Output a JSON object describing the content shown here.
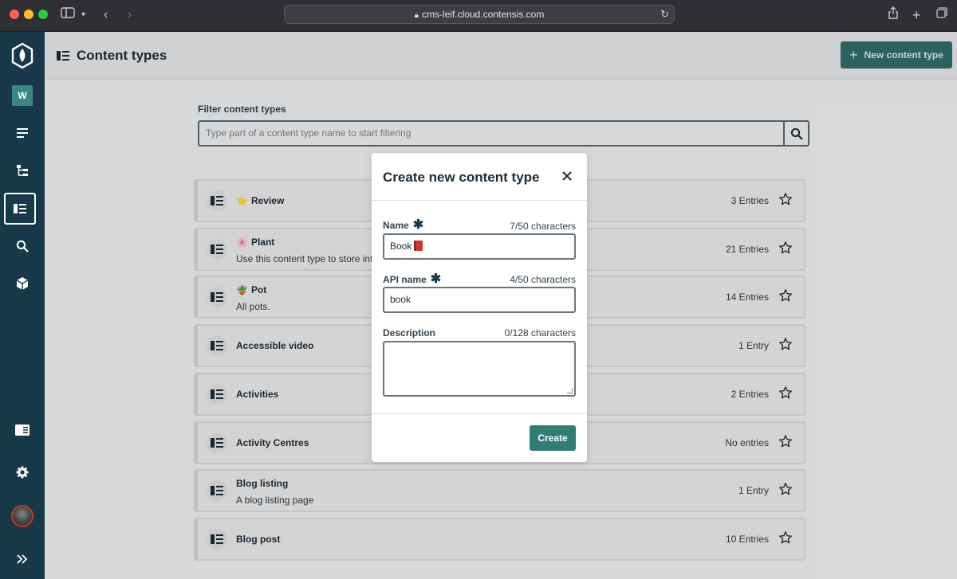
{
  "browser": {
    "url": "cms-leif.cloud.contensis.com"
  },
  "sidebar": {
    "workspace_initial": "W"
  },
  "header": {
    "title": "Content types",
    "new_button_label": "New content type"
  },
  "filter": {
    "label": "Filter content types",
    "placeholder": "Type part of a content type name to start filtering"
  },
  "content_types": [
    {
      "emoji": "⭐",
      "name": "Review",
      "description": "",
      "count": "3 Entries"
    },
    {
      "emoji": "🌸",
      "name": "Plant",
      "description": "Use this content type to store inf",
      "count": "21 Entries"
    },
    {
      "emoji": "🪴",
      "name": "Pot",
      "description": "All pots.",
      "count": "14 Entries"
    },
    {
      "emoji": "",
      "name": "Accessible video",
      "description": "",
      "count": "1 Entry"
    },
    {
      "emoji": "",
      "name": "Activities",
      "description": "",
      "count": "2 Entries"
    },
    {
      "emoji": "",
      "name": "Activity Centres",
      "description": "",
      "count": "No entries"
    },
    {
      "emoji": "",
      "name": "Blog listing",
      "description": "A blog listing page",
      "count": "1 Entry"
    },
    {
      "emoji": "",
      "name": "Blog post",
      "description": "",
      "count": "10 Entries"
    }
  ],
  "modal": {
    "title": "Create new content type",
    "name_label": "Name",
    "name_count": "7/50 characters",
    "name_value": "Book",
    "api_label": "API name",
    "api_count": "4/50 characters",
    "api_value": "book",
    "description_label": "Description",
    "description_count": "0/128 characters",
    "description_value": "",
    "create_label": "Create"
  },
  "colors": {
    "sidebar": "#18394a",
    "primary_button": "#2f7d75",
    "workspace_badge": "#38897f"
  }
}
